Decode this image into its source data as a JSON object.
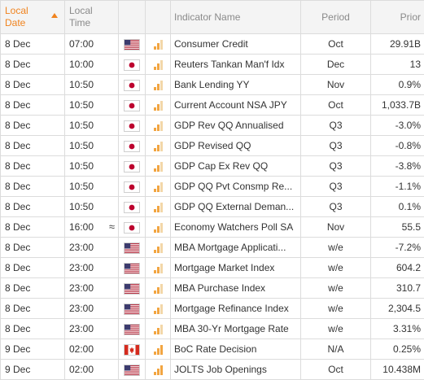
{
  "header": {
    "local_date": "Local Date",
    "local_time": "Local Time",
    "indicator_name": "Indicator Name",
    "period": "Period",
    "prior": "Prior"
  },
  "colors": {
    "header_active": "#f0831e",
    "bar_active": "#f2a541",
    "bar_inactive": "#f3d7a8"
  },
  "rows": [
    {
      "date": "8 Dec",
      "time": "07:00",
      "approx": "",
      "country": "US",
      "flag_icon": "us-flag-icon",
      "importance": 2,
      "name": "Consumer Credit",
      "period": "Oct",
      "prior": "29.91B"
    },
    {
      "date": "8 Dec",
      "time": "10:00",
      "approx": "",
      "country": "JP",
      "flag_icon": "japan-flag-icon",
      "importance": 2,
      "name": "Reuters Tankan Man'f Idx",
      "period": "Dec",
      "prior": "13"
    },
    {
      "date": "8 Dec",
      "time": "10:50",
      "approx": "",
      "country": "JP",
      "flag_icon": "japan-flag-icon",
      "importance": 2,
      "name": "Bank Lending YY",
      "period": "Nov",
      "prior": "0.9%"
    },
    {
      "date": "8 Dec",
      "time": "10:50",
      "approx": "",
      "country": "JP",
      "flag_icon": "japan-flag-icon",
      "importance": 2,
      "name": "Current Account NSA JPY",
      "period": "Oct",
      "prior": "1,033.7B"
    },
    {
      "date": "8 Dec",
      "time": "10:50",
      "approx": "",
      "country": "JP",
      "flag_icon": "japan-flag-icon",
      "importance": 2,
      "name": "GDP Rev QQ Annualised",
      "period": "Q3",
      "prior": "-3.0%"
    },
    {
      "date": "8 Dec",
      "time": "10:50",
      "approx": "",
      "country": "JP",
      "flag_icon": "japan-flag-icon",
      "importance": 2,
      "name": "GDP Revised QQ",
      "period": "Q3",
      "prior": "-0.8%"
    },
    {
      "date": "8 Dec",
      "time": "10:50",
      "approx": "",
      "country": "JP",
      "flag_icon": "japan-flag-icon",
      "importance": 2,
      "name": "GDP Cap Ex Rev QQ",
      "period": "Q3",
      "prior": "-3.8%"
    },
    {
      "date": "8 Dec",
      "time": "10:50",
      "approx": "",
      "country": "JP",
      "flag_icon": "japan-flag-icon",
      "importance": 2,
      "name": "GDP QQ Pvt Consmp Re...",
      "period": "Q3",
      "prior": "-1.1%"
    },
    {
      "date": "8 Dec",
      "time": "10:50",
      "approx": "",
      "country": "JP",
      "flag_icon": "japan-flag-icon",
      "importance": 2,
      "name": "GDP QQ External Deman...",
      "period": "Q3",
      "prior": "0.1%"
    },
    {
      "date": "8 Dec",
      "time": "16:00",
      "approx": "≈",
      "country": "JP",
      "flag_icon": "japan-flag-icon",
      "importance": 2,
      "name": "Economy Watchers Poll SA",
      "period": "Nov",
      "prior": "55.5"
    },
    {
      "date": "8 Dec",
      "time": "23:00",
      "approx": "",
      "country": "US",
      "flag_icon": "us-flag-icon",
      "importance": 2,
      "name": "MBA Mortgage Applicati...",
      "period": "w/e",
      "prior": "-7.2%"
    },
    {
      "date": "8 Dec",
      "time": "23:00",
      "approx": "",
      "country": "US",
      "flag_icon": "us-flag-icon",
      "importance": 2,
      "name": "Mortgage Market Index",
      "period": "w/e",
      "prior": "604.2"
    },
    {
      "date": "8 Dec",
      "time": "23:00",
      "approx": "",
      "country": "US",
      "flag_icon": "us-flag-icon",
      "importance": 2,
      "name": "MBA Purchase Index",
      "period": "w/e",
      "prior": "310.7"
    },
    {
      "date": "8 Dec",
      "time": "23:00",
      "approx": "",
      "country": "US",
      "flag_icon": "us-flag-icon",
      "importance": 2,
      "name": "Mortgage Refinance Index",
      "period": "w/e",
      "prior": "2,304.5"
    },
    {
      "date": "8 Dec",
      "time": "23:00",
      "approx": "",
      "country": "US",
      "flag_icon": "us-flag-icon",
      "importance": 2,
      "name": "MBA 30-Yr Mortgage Rate",
      "period": "w/e",
      "prior": "3.31%"
    },
    {
      "date": "9 Dec",
      "time": "02:00",
      "approx": "",
      "country": "CA",
      "flag_icon": "canada-flag-icon",
      "importance": 3,
      "name": "BoC Rate Decision",
      "period": "N/A",
      "prior": "0.25%"
    },
    {
      "date": "9 Dec",
      "time": "02:00",
      "approx": "",
      "country": "US",
      "flag_icon": "us-flag-icon",
      "importance": 3,
      "name": "JOLTS Job Openings",
      "period": "Oct",
      "prior": "10.438M"
    }
  ]
}
